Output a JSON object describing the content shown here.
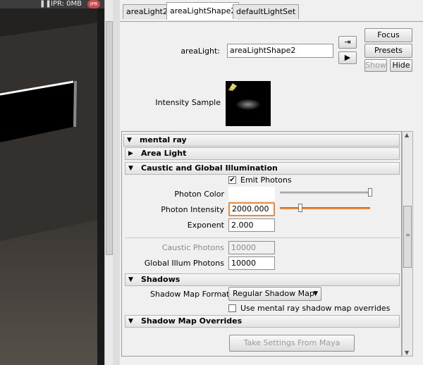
{
  "viewport": {
    "ipr_label": "IPR: 0MB",
    "ipr_badge": "IPR"
  },
  "tabs": [
    {
      "label": "areaLight2",
      "active": false
    },
    {
      "label": "areaLightShape2",
      "active": true
    },
    {
      "label": "defaultLightSet",
      "active": false
    }
  ],
  "header": {
    "node_label": "areaLight:",
    "node_value": "areaLightShape2",
    "focus_label": "Focus",
    "presets_label": "Presets",
    "show_label": "Show",
    "hide_label": "Hide",
    "intensity_sample_label": "Intensity Sample"
  },
  "sections": {
    "mental_ray": "mental ray",
    "area_light": "Area Light",
    "caustic_gi": "Caustic and Global Illumination",
    "shadows": "Shadows",
    "shadow_map_overrides": "Shadow Map Overrides"
  },
  "caustic_gi": {
    "emit_photons_label": "Emit Photons",
    "emit_photons_checked": true,
    "photon_color_label": "Photon Color",
    "photon_intensity_label": "Photon Intensity",
    "photon_intensity_value": "2000.000",
    "exponent_label": "Exponent",
    "exponent_value": "2.000",
    "caustic_photons_label": "Caustic Photons",
    "caustic_photons_value": "10000",
    "global_illum_photons_label": "Global Illum Photons",
    "global_illum_photons_value": "10000"
  },
  "shadows": {
    "shadow_map_format_label": "Shadow Map Format",
    "shadow_map_format_value": "Regular Shadow Map",
    "use_overrides_label": "Use mental ray shadow map overrides",
    "use_overrides_checked": false
  },
  "shadow_map_overrides": {
    "take_settings_label": "Take Settings From Maya"
  },
  "colors": {
    "accent": "#e8893c",
    "photon_color": "#ffffff"
  }
}
